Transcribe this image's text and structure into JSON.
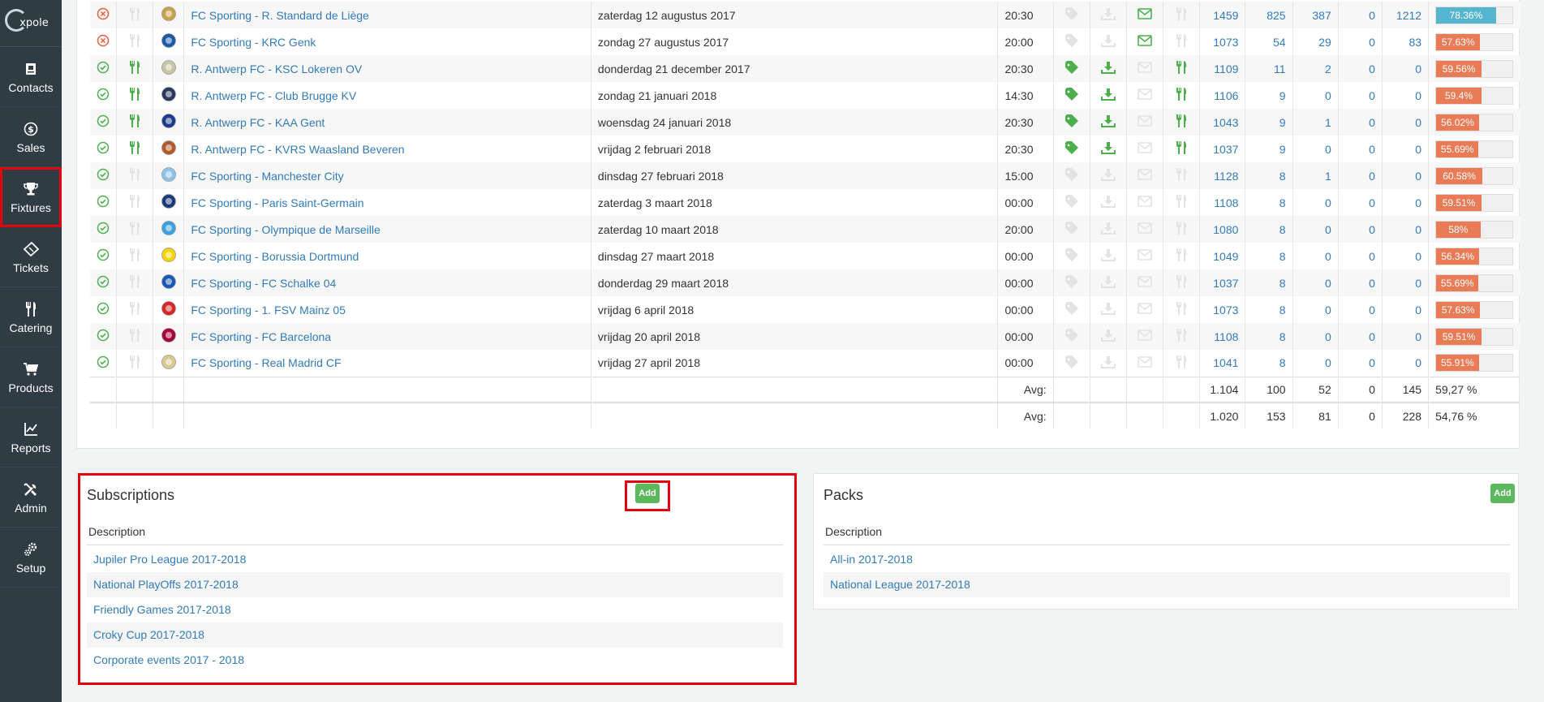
{
  "brand": {
    "logo_text": "xpole"
  },
  "sidebar": {
    "items": [
      {
        "label": "Contacts",
        "icon": "contacts-icon",
        "active": false
      },
      {
        "label": "Sales",
        "icon": "dollar-icon",
        "active": false
      },
      {
        "label": "Fixtures",
        "icon": "trophy-icon",
        "active": true
      },
      {
        "label": "Tickets",
        "icon": "ticket-icon",
        "active": false
      },
      {
        "label": "Catering",
        "icon": "cutlery-icon",
        "active": false
      },
      {
        "label": "Products",
        "icon": "cart-icon",
        "active": false
      },
      {
        "label": "Reports",
        "icon": "chart-icon",
        "active": false
      },
      {
        "label": "Admin",
        "icon": "tools-icon",
        "active": false
      },
      {
        "label": "Setup",
        "icon": "cogs-icon",
        "active": false
      }
    ]
  },
  "fixtures": {
    "rows": [
      {
        "status": "cancelled",
        "catering": false,
        "match": "FC Sporting - R. Standard de Liège",
        "date": "zaterdag 12 augustus 2017",
        "time": "20:30",
        "tag": false,
        "download": false,
        "mail": true,
        "cater2": false,
        "n1": "1459",
        "n2": "825",
        "n3": "387",
        "n4": "0",
        "n5": "1212",
        "pct_label": "78.36%",
        "pct": 78.36,
        "bar": "blue"
      },
      {
        "status": "cancelled",
        "catering": false,
        "match": "FC Sporting - KRC Genk",
        "date": "zondag 27 augustus 2017",
        "time": "20:00",
        "tag": false,
        "download": false,
        "mail": true,
        "cater2": false,
        "n1": "1073",
        "n2": "54",
        "n3": "29",
        "n4": "0",
        "n5": "83",
        "pct_label": "57.63%",
        "pct": 57.63,
        "bar": "orange"
      },
      {
        "status": "ok",
        "catering": true,
        "match": "R. Antwerp FC - KSC Lokeren OV",
        "date": "donderdag 21 december 2017",
        "time": "20:30",
        "tag": true,
        "download": true,
        "mail": false,
        "cater2": true,
        "n1": "1109",
        "n2": "11",
        "n3": "2",
        "n4": "0",
        "n5": "0",
        "pct_label": "59.56%",
        "pct": 59.56,
        "bar": "orange"
      },
      {
        "status": "ok",
        "catering": true,
        "match": "R. Antwerp FC - Club Brugge KV",
        "date": "zondag 21 januari 2018",
        "time": "14:30",
        "tag": true,
        "download": true,
        "mail": false,
        "cater2": true,
        "n1": "1106",
        "n2": "9",
        "n3": "0",
        "n4": "0",
        "n5": "0",
        "pct_label": "59.4%",
        "pct": 59.4,
        "bar": "orange"
      },
      {
        "status": "ok",
        "catering": true,
        "match": "R. Antwerp FC - KAA Gent",
        "date": "woensdag 24 januari 2018",
        "time": "20:30",
        "tag": true,
        "download": true,
        "mail": false,
        "cater2": true,
        "n1": "1043",
        "n2": "9",
        "n3": "1",
        "n4": "0",
        "n5": "0",
        "pct_label": "56.02%",
        "pct": 56.02,
        "bar": "orange"
      },
      {
        "status": "ok",
        "catering": true,
        "match": "R. Antwerp FC - KVRS Waasland Beveren",
        "date": "vrijdag 2 februari 2018",
        "time": "20:30",
        "tag": true,
        "download": true,
        "mail": false,
        "cater2": true,
        "n1": "1037",
        "n2": "9",
        "n3": "0",
        "n4": "0",
        "n5": "0",
        "pct_label": "55.69%",
        "pct": 55.69,
        "bar": "orange"
      },
      {
        "status": "ok",
        "catering": false,
        "match": "FC Sporting - Manchester City",
        "date": "dinsdag 27 februari 2018",
        "time": "15:00",
        "tag": false,
        "download": false,
        "mail": false,
        "cater2": false,
        "n1": "1128",
        "n2": "8",
        "n3": "1",
        "n4": "0",
        "n5": "0",
        "pct_label": "60.58%",
        "pct": 60.58,
        "bar": "orange"
      },
      {
        "status": "ok",
        "catering": false,
        "match": "FC Sporting - Paris Saint-Germain",
        "date": "zaterdag 3 maart 2018",
        "time": "00:00",
        "tag": false,
        "download": false,
        "mail": false,
        "cater2": false,
        "n1": "1108",
        "n2": "8",
        "n3": "0",
        "n4": "0",
        "n5": "0",
        "pct_label": "59.51%",
        "pct": 59.51,
        "bar": "orange"
      },
      {
        "status": "ok",
        "catering": false,
        "match": "FC Sporting - Olympique de Marseille",
        "date": "zaterdag 10 maart 2018",
        "time": "20:00",
        "tag": false,
        "download": false,
        "mail": false,
        "cater2": false,
        "n1": "1080",
        "n2": "8",
        "n3": "0",
        "n4": "0",
        "n5": "0",
        "pct_label": "58%",
        "pct": 58,
        "bar": "orange"
      },
      {
        "status": "ok",
        "catering": false,
        "match": "FC Sporting - Borussia Dortmund",
        "date": "dinsdag 27 maart 2018",
        "time": "00:00",
        "tag": false,
        "download": false,
        "mail": false,
        "cater2": false,
        "n1": "1049",
        "n2": "8",
        "n3": "0",
        "n4": "0",
        "n5": "0",
        "pct_label": "56.34%",
        "pct": 56.34,
        "bar": "orange"
      },
      {
        "status": "ok",
        "catering": false,
        "match": "FC Sporting - FC Schalke 04",
        "date": "donderdag 29 maart 2018",
        "time": "00:00",
        "tag": false,
        "download": false,
        "mail": false,
        "cater2": false,
        "n1": "1037",
        "n2": "8",
        "n3": "0",
        "n4": "0",
        "n5": "0",
        "pct_label": "55.69%",
        "pct": 55.69,
        "bar": "orange"
      },
      {
        "status": "ok",
        "catering": false,
        "match": "FC Sporting - 1. FSV Mainz 05",
        "date": "vrijdag 6 april 2018",
        "time": "00:00",
        "tag": false,
        "download": false,
        "mail": false,
        "cater2": false,
        "n1": "1073",
        "n2": "8",
        "n3": "0",
        "n4": "0",
        "n5": "0",
        "pct_label": "57.63%",
        "pct": 57.63,
        "bar": "orange"
      },
      {
        "status": "ok",
        "catering": false,
        "match": "FC Sporting - FC Barcelona",
        "date": "vrijdag 20 april 2018",
        "time": "00:00",
        "tag": false,
        "download": false,
        "mail": false,
        "cater2": false,
        "n1": "1108",
        "n2": "8",
        "n3": "0",
        "n4": "0",
        "n5": "0",
        "pct_label": "59.51%",
        "pct": 59.51,
        "bar": "orange"
      },
      {
        "status": "ok",
        "catering": false,
        "match": "FC Sporting - Real Madrid CF",
        "date": "vrijdag 27 april 2018",
        "time": "00:00",
        "tag": false,
        "download": false,
        "mail": false,
        "cater2": false,
        "n1": "1041",
        "n2": "8",
        "n3": "0",
        "n4": "0",
        "n5": "0",
        "pct_label": "55.91%",
        "pct": 55.91,
        "bar": "orange"
      }
    ],
    "averages": [
      {
        "label": "Avg:",
        "n1": "1.104",
        "n2": "100",
        "n3": "52",
        "n4": "0",
        "n5": "145",
        "pct": "59,27 %"
      },
      {
        "label": "Avg:",
        "n1": "1.020",
        "n2": "153",
        "n3": "81",
        "n4": "0",
        "n5": "228",
        "pct": "54,76 %"
      }
    ]
  },
  "subscriptions": {
    "title": "Subscriptions",
    "add_label": "Add",
    "column_header": "Description",
    "items": [
      "Jupiler Pro League 2017-2018",
      "National PlayOffs 2017-2018",
      "Friendly Games 2017-2018",
      "Croky Cup 2017-2018",
      "Corporate events 2017 - 2018"
    ]
  },
  "packs": {
    "title": "Packs",
    "add_label": "Add",
    "column_header": "Description",
    "items": [
      "All-in 2017-2018",
      "National League 2017-2018"
    ]
  },
  "colors": {
    "sidebar_bg": "#2f3c44",
    "highlight": "#e3000f",
    "link": "#337ab7",
    "success": "#4cae4c",
    "danger": "#e5603b",
    "bar_orange": "#e97c56",
    "bar_blue": "#55b5cf",
    "add_button": "#5cb85c"
  }
}
